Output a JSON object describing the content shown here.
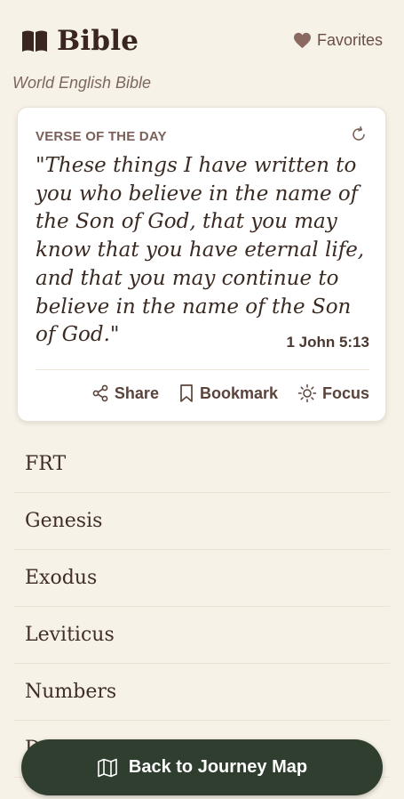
{
  "header": {
    "title": "Bible",
    "favorites_label": "Favorites",
    "translation": "World English Bible"
  },
  "verse_of_day": {
    "label": "VERSE OF THE DAY",
    "text": "\"These things I have written to you who believe in the name of the Son of God, that you may know that you have eternal life, and that you may continue to believe in the name of the Son of God.\"",
    "reference": "1 John 5:13",
    "actions": {
      "share": "Share",
      "bookmark": "Bookmark",
      "focus": "Focus"
    }
  },
  "books": [
    "FRT",
    "Genesis",
    "Exodus",
    "Leviticus",
    "Numbers",
    "Deuteronomy"
  ],
  "bottom_button": {
    "label": "Back to Journey Map"
  },
  "colors": {
    "background": "#f7f2e8",
    "card": "#ffffff",
    "button": "#2f3e2e",
    "accent": "#8a6a60"
  }
}
